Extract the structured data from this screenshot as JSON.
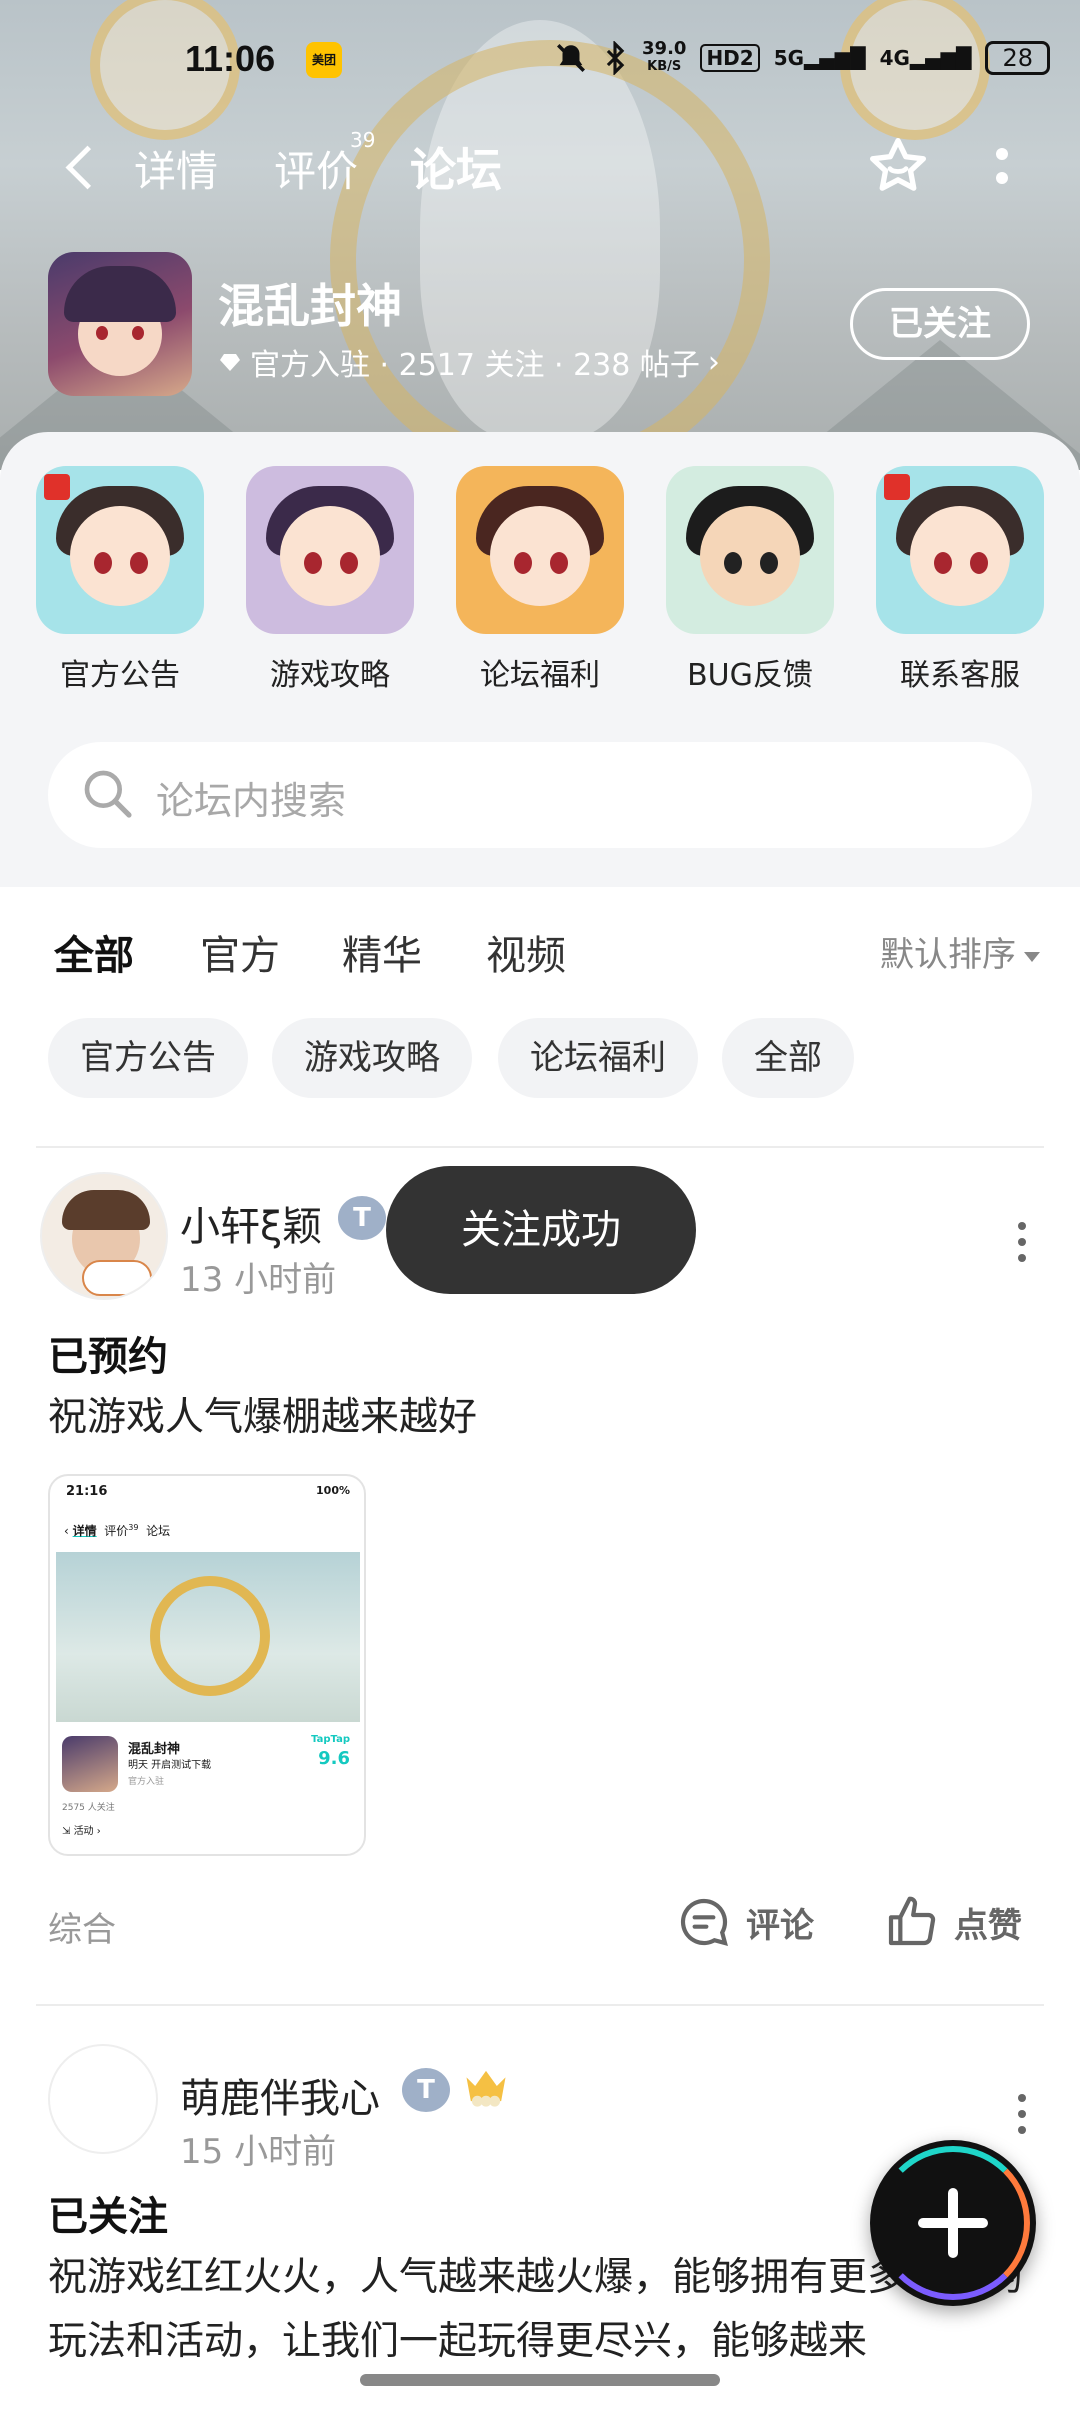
{
  "status_bar": {
    "time": "11:06",
    "app_badge": "美团",
    "net_speed_value": "39.0",
    "net_speed_unit": "KB/S",
    "hd_label": "HD2",
    "net_5g": "5G",
    "net_4g": "4G",
    "battery": "28"
  },
  "nav": {
    "tabs": [
      {
        "label": "详情"
      },
      {
        "label": "评价",
        "count": "39"
      },
      {
        "label": "论坛"
      }
    ],
    "active_tab": "论坛"
  },
  "game": {
    "name": "混乱封神",
    "meta": "官方入驻 · 2517 关注 · 238 帖子",
    "follow_label": "已关注"
  },
  "shortcuts": [
    {
      "label": "官方公告"
    },
    {
      "label": "游戏攻略"
    },
    {
      "label": "论坛福利"
    },
    {
      "label": "BUG反馈"
    },
    {
      "label": "联系客服"
    }
  ],
  "search": {
    "placeholder": "论坛内搜索"
  },
  "feed_tabs": [
    {
      "label": "全部"
    },
    {
      "label": "官方"
    },
    {
      "label": "精华"
    },
    {
      "label": "视频"
    }
  ],
  "active_feed_tab": "全部",
  "sort_label": "默认排序",
  "chips": [
    {
      "label": "官方公告"
    },
    {
      "label": "游戏攻略"
    },
    {
      "label": "论坛福利"
    },
    {
      "label": "全部"
    }
  ],
  "posts": [
    {
      "username": "小轩ξ颖",
      "time": "13 小时前",
      "title": "已预约",
      "body": "祝游戏人气爆棚越来越好",
      "thumbnail": {
        "time": "21:16",
        "status_right": "100%",
        "nav_tabs": [
          "详情",
          "评价",
          "论坛"
        ],
        "nav_count": "39",
        "game_name": "混乱封神",
        "game_sub": "明天 开启测试下载",
        "official": "官方入驻",
        "followers": "2575 人关注",
        "rating_brand": "TapTap",
        "rating": "9.6",
        "tag": "活动"
      },
      "category": "综合",
      "comment_label": "评论",
      "like_label": "点赞"
    },
    {
      "username": "萌鹿伴我心",
      "time": "15 小时前",
      "title": "已关注",
      "body": "祝游戏红红火火，人气越来越火爆，能够拥有更多种类的玩法和活动，让我们一起玩得更尽兴，能够越来"
    }
  ],
  "toast": "关注成功",
  "colors": {
    "accent": "#14c9c0",
    "toast_bg": "#333333",
    "panel_bg": "#f4f5f7",
    "chip_bg": "#f2f3f5"
  }
}
